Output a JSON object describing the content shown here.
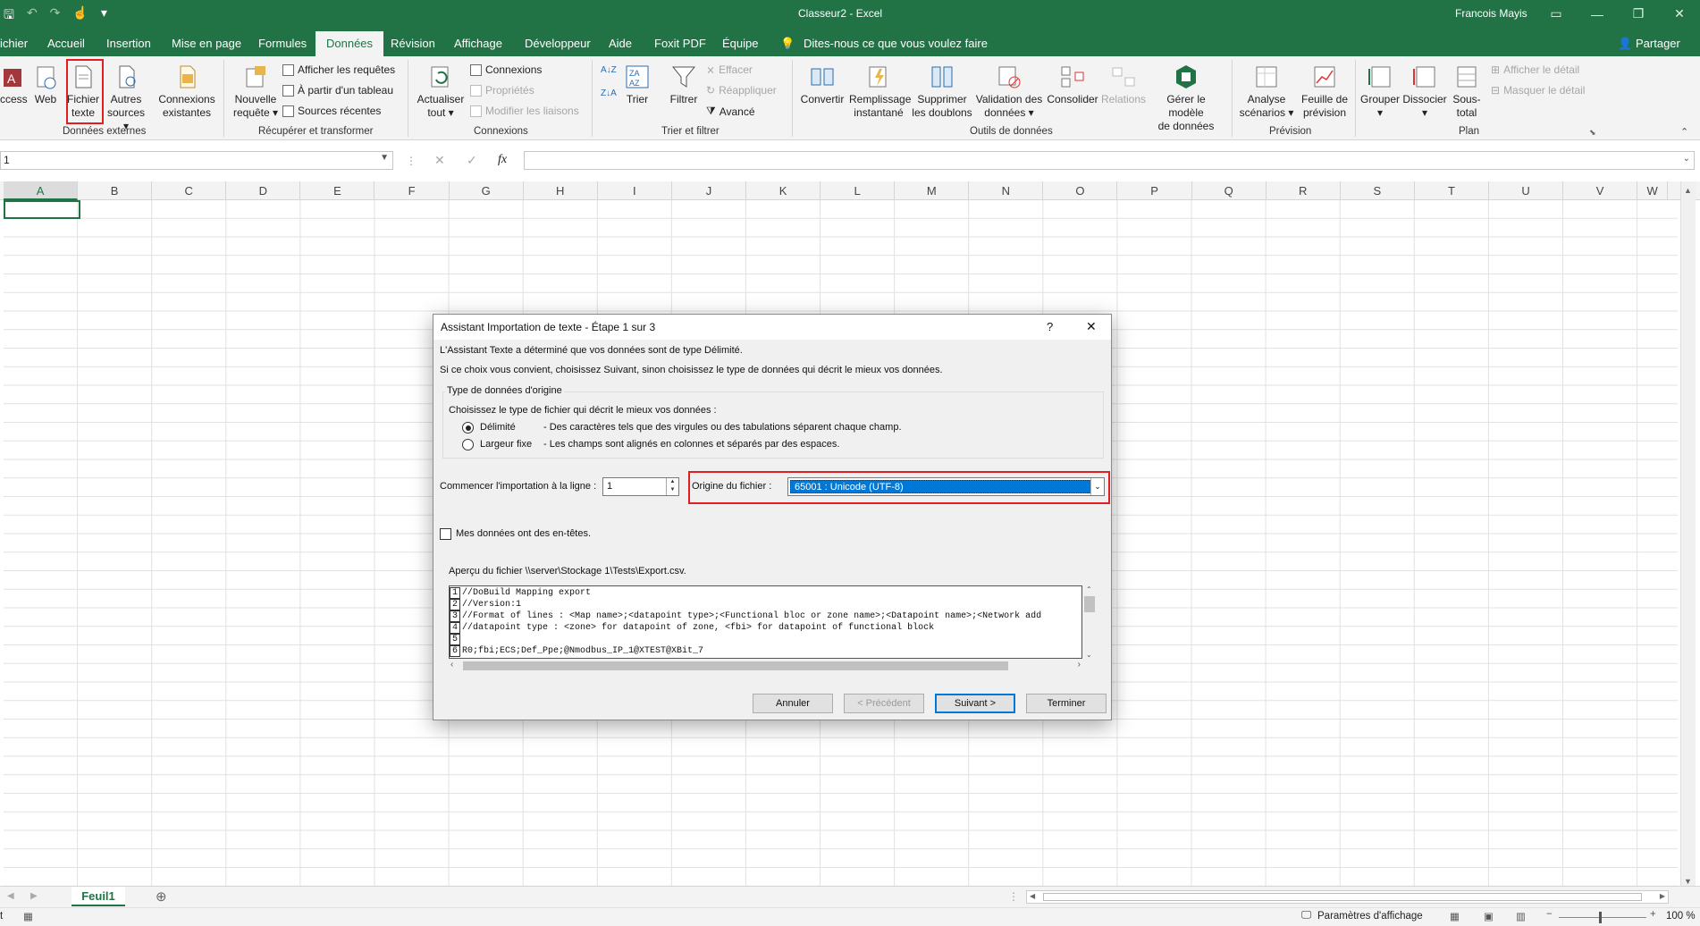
{
  "window": {
    "title": "Classeur2 - Excel",
    "user": "Francois Mayis",
    "minimize_icon": "minimize-icon",
    "restore_icon": "restore-icon",
    "close_icon": "close-icon"
  },
  "menu": {
    "tabs": [
      "ichier",
      "Accueil",
      "Insertion",
      "Mise en page",
      "Formules",
      "Données",
      "Révision",
      "Affichage",
      "Développeur",
      "Aide",
      "Foxit PDF",
      "Équipe"
    ],
    "active": "Données",
    "tellme": "Dites-nous ce que vous voulez faire",
    "share": "Partager"
  },
  "ribbon": {
    "access": "ccess",
    "web": "Web",
    "fichier_texte": [
      "Fichier",
      "texte"
    ],
    "autres_sources": [
      "Autres",
      "sources ▾"
    ],
    "connexions_existantes": [
      "Connexions",
      "existantes"
    ],
    "group_externes": "Données externes",
    "nouvelle_requete": [
      "Nouvelle",
      "requête ▾"
    ],
    "afficher_requetes": "Afficher les requêtes",
    "partir_tableau": "À partir d'un tableau",
    "sources_recentes": "Sources récentes",
    "group_recuperer": "Récupérer et transformer",
    "actualiser": [
      "Actualiser",
      "tout ▾"
    ],
    "connexions": "Connexions",
    "proprietes": "Propriétés",
    "modifier_liaisons": "Modifier les liaisons",
    "group_connexions": "Connexions",
    "trier": "Trier",
    "filtrer": "Filtrer",
    "effacer": "Effacer",
    "reappliquer": "Réappliquer",
    "avance": "Avancé",
    "group_trier": "Trier et filtrer",
    "convertir": "Convertir",
    "remplissage": [
      "Remplissage",
      "instantané"
    ],
    "supprimer": [
      "Supprimer",
      "les doublons"
    ],
    "validation": [
      "Validation des",
      "données ▾"
    ],
    "consolider": "Consolider",
    "relations": "Relations",
    "gerer": [
      "Gérer le modèle",
      "de données"
    ],
    "group_outils": "Outils de données",
    "analyse": [
      "Analyse",
      "scénarios ▾"
    ],
    "feuille_prevision": [
      "Feuille de",
      "prévision"
    ],
    "group_prevision": "Prévision",
    "grouper": [
      "Grouper",
      "▾"
    ],
    "dissocier": [
      "Dissocier",
      "▾"
    ],
    "sous_total": [
      "Sous-",
      "total"
    ],
    "afficher_detail": "Afficher le détail",
    "masquer_detail": "Masquer le détail",
    "group_plan": "Plan"
  },
  "formula_bar": {
    "namebox": "1",
    "fx": "fx",
    "cancel": "✕",
    "enter": "✓"
  },
  "columns": [
    "A",
    "B",
    "C",
    "D",
    "E",
    "F",
    "G",
    "H",
    "I",
    "J",
    "K",
    "L",
    "M",
    "N",
    "O",
    "P",
    "Q",
    "R",
    "S",
    "T",
    "U",
    "V",
    "W"
  ],
  "sheet": {
    "tab": "Feuil1",
    "add": "⊕"
  },
  "status": {
    "mode": "t",
    "params": "Paramètres d'affichage",
    "zoom": "100 %"
  },
  "dialog": {
    "title": "Assistant Importation de texte - Étape 1 sur 3",
    "help": "?",
    "close": "✕",
    "line1": "L'Assistant Texte a déterminé que vos données sont de type Délimité.",
    "line2": "Si ce choix vous convient, choisissez Suivant, sinon choisissez le type de données qui décrit le mieux vos données.",
    "legend": "Type de données d'origine",
    "choose": "Choisissez le type de fichier qui décrit le mieux vos données :",
    "opt1": "Délimité",
    "opt1_desc": "- Des caractères tels que des virgules ou des tabulations séparent chaque champ.",
    "opt2": "Largeur fixe",
    "opt2_desc": "- Les champs sont alignés en colonnes et séparés par des espaces.",
    "start_label": "Commencer l'importation à la ligne :",
    "start_value": "1",
    "origin_label": "Origine du fichier :",
    "origin_value": "65001 : Unicode (UTF-8)",
    "headers": "Mes données ont des en-têtes.",
    "preview_label": "Aperçu du fichier \\\\server\\Stockage 1\\Tests\\Export.csv.",
    "preview": [
      {
        "n": "1",
        "t": "//DoBuild Mapping export"
      },
      {
        "n": "2",
        "t": "//Version:1"
      },
      {
        "n": "3",
        "t": "//Format of lines : <Map name>;<datapoint type>;<Functional bloc or zone name>;<Datapoint name>;<Network add"
      },
      {
        "n": "4",
        "t": "//datapoint type : <zone> for datapoint of zone, <fbi> for datapoint of functional block"
      },
      {
        "n": "5",
        "t": ""
      },
      {
        "n": "6",
        "t": "R0;fbi;ECS;Def_Ppe;@Nmodbus_IP_1@XTEST@XBit_7"
      }
    ],
    "btn_cancel": "Annuler",
    "btn_prev": "< Précédent",
    "btn_next": "Suivant >",
    "btn_finish": "Terminer"
  },
  "colors": {
    "brand": "#217346",
    "highlight": "#e02020",
    "selection": "#0078d7"
  }
}
